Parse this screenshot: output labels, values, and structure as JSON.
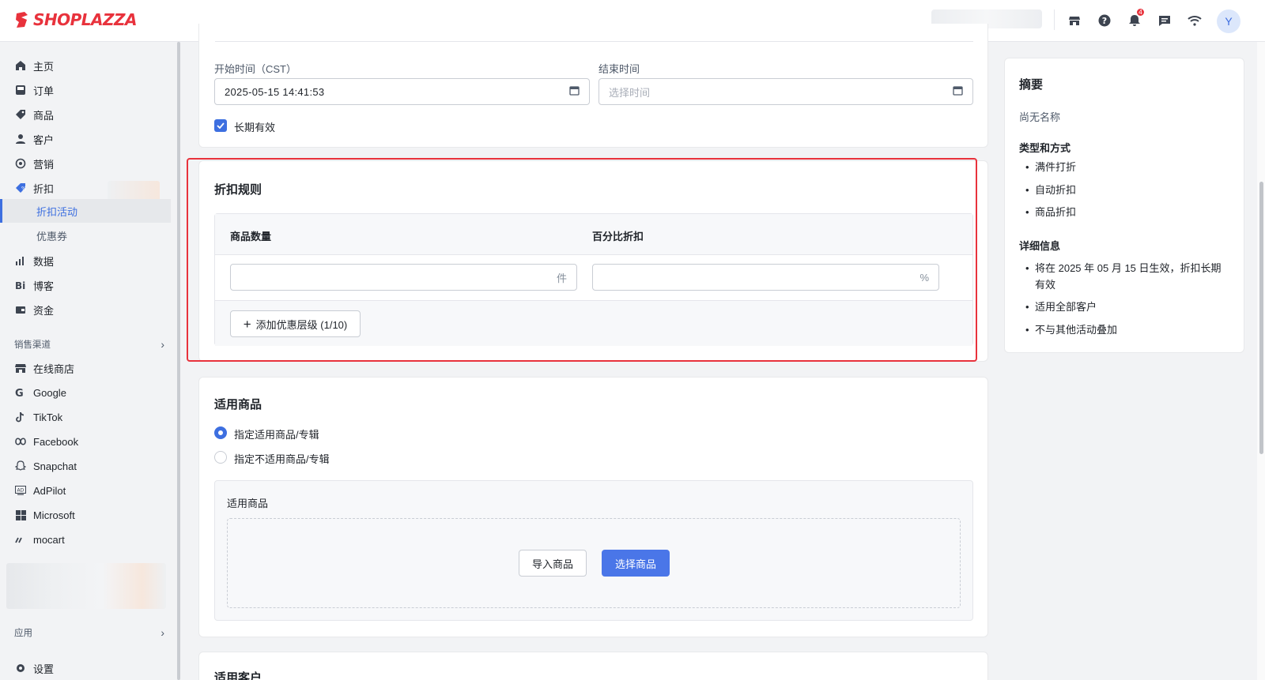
{
  "brand": {
    "name": "SHOPLAZZA"
  },
  "topbar": {
    "notification_count": "4",
    "avatar_letter": "Y"
  },
  "sidebar": {
    "items": [
      {
        "label": "主页",
        "icon": "home-icon"
      },
      {
        "label": "订单",
        "icon": "inbox-icon"
      },
      {
        "label": "商品",
        "icon": "tag-icon"
      },
      {
        "label": "客户",
        "icon": "person-icon"
      },
      {
        "label": "营销",
        "icon": "target-icon"
      },
      {
        "label": "折扣",
        "icon": "discount-icon"
      }
    ],
    "discount_sub": [
      {
        "label": "折扣活动",
        "active": true
      },
      {
        "label": "优惠券",
        "active": false
      }
    ],
    "items2": [
      {
        "label": "数据",
        "icon": "bar-chart-icon"
      },
      {
        "label": "博客",
        "icon": "blog-icon"
      },
      {
        "label": "资金",
        "icon": "wallet-icon"
      }
    ],
    "sales_channel_label": "销售渠道",
    "channels": [
      {
        "label": "在线商店",
        "icon": "store-icon"
      },
      {
        "label": "Google",
        "icon": "google-icon"
      },
      {
        "label": "TikTok",
        "icon": "tiktok-icon"
      },
      {
        "label": "Facebook",
        "icon": "meta-icon"
      },
      {
        "label": "Snapchat",
        "icon": "ghost-icon"
      },
      {
        "label": "AdPilot",
        "icon": "ad-icon"
      },
      {
        "label": "Microsoft",
        "icon": "windows-icon"
      },
      {
        "label": "mocart",
        "icon": "mocart-icon"
      }
    ],
    "apps_label": "应用",
    "settings_label": "设置"
  },
  "time_card": {
    "start_label": "开始时间（CST）",
    "start_value": "2025-05-15 14:41:53",
    "end_label": "结束时间",
    "end_placeholder": "选择时间",
    "long_term_label": "长期有效",
    "long_term_checked": true
  },
  "rules_card": {
    "title": "折扣规则",
    "col_quantity": "商品数量",
    "col_percent": "百分比折扣",
    "quantity_suffix": "件",
    "percent_suffix": "%",
    "add_tier_label": "添加优惠层级 (1/10)"
  },
  "products_card": {
    "title": "适用商品",
    "options": [
      "指定适用商品/专辑",
      "指定不适用商品/专辑"
    ],
    "selected_option": 0,
    "box_title": "适用商品",
    "import_label": "导入商品",
    "select_label": "选择商品"
  },
  "customers_card": {
    "title": "适用客户"
  },
  "summary": {
    "title": "摘要",
    "no_name": "尚无名称",
    "type_heading": "类型和方式",
    "type_items": [
      "满件打折",
      "自动折扣",
      "商品折扣"
    ],
    "detail_heading": "详细信息",
    "detail_items": [
      "将在 2025 年 05 月 15 日生效，折扣长期有效",
      "适用全部客户",
      "不与其他活动叠加"
    ]
  },
  "colors": {
    "brand_red": "#e8323c",
    "accent_blue": "#3d6fe0",
    "highlight_border": "#e8323c"
  }
}
